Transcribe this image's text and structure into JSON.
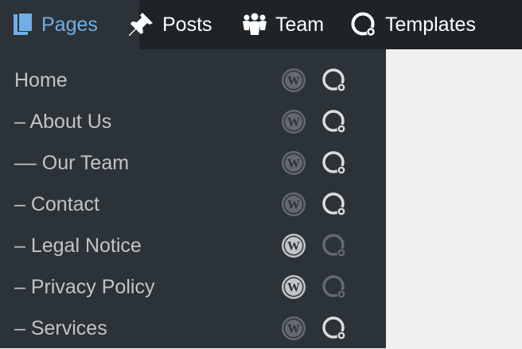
{
  "tabs": {
    "pages": "Pages",
    "posts": "Posts",
    "team": "Team",
    "templates": "Templates"
  },
  "colors": {
    "active_tab": "#72aee6",
    "topbar_bg": "#1d2327",
    "panel_bg": "#2c3338",
    "text": "#c3c4c7",
    "wp_dim": "#646970",
    "wp_bright": "#c3c4c7",
    "q_bright": "#dcdcde",
    "q_dim": "#646970"
  },
  "pages": [
    {
      "label": "Home",
      "wp": "dim",
      "q": "bright"
    },
    {
      "label": "– About Us",
      "wp": "dim",
      "q": "bright"
    },
    {
      "label": "–– Our Team",
      "wp": "dim",
      "q": "bright"
    },
    {
      "label": "– Contact",
      "wp": "dim",
      "q": "bright"
    },
    {
      "label": "– Legal Notice",
      "wp": "bright",
      "q": "dim"
    },
    {
      "label": "– Privacy Policy",
      "wp": "bright",
      "q": "dim"
    },
    {
      "label": "– Services",
      "wp": "dim",
      "q": "bright"
    }
  ]
}
